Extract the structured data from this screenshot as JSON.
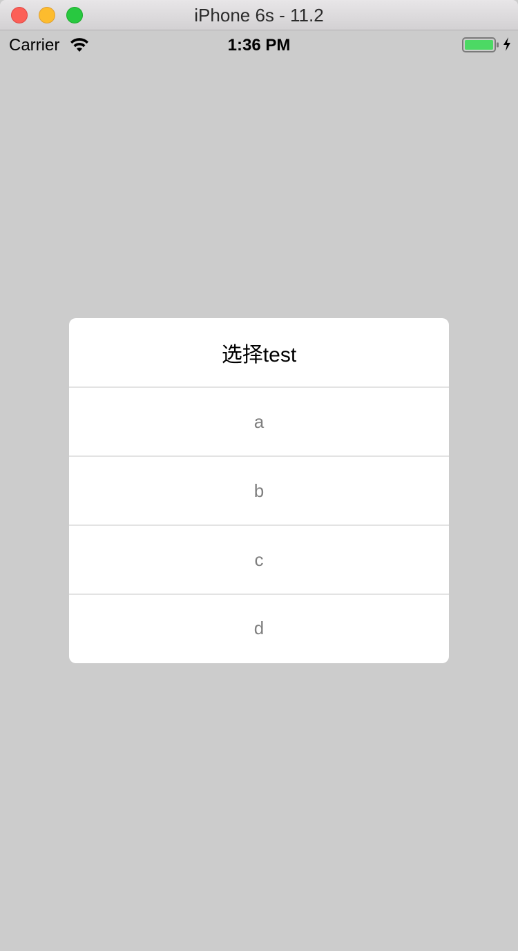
{
  "window": {
    "title": "iPhone 6s - 11.2"
  },
  "status_bar": {
    "carrier": "Carrier",
    "time": "1:36 PM",
    "battery_color": "#4cd964"
  },
  "dialog": {
    "title": "选择test",
    "options": [
      {
        "label": "a"
      },
      {
        "label": "b"
      },
      {
        "label": "c"
      },
      {
        "label": "d"
      }
    ]
  }
}
